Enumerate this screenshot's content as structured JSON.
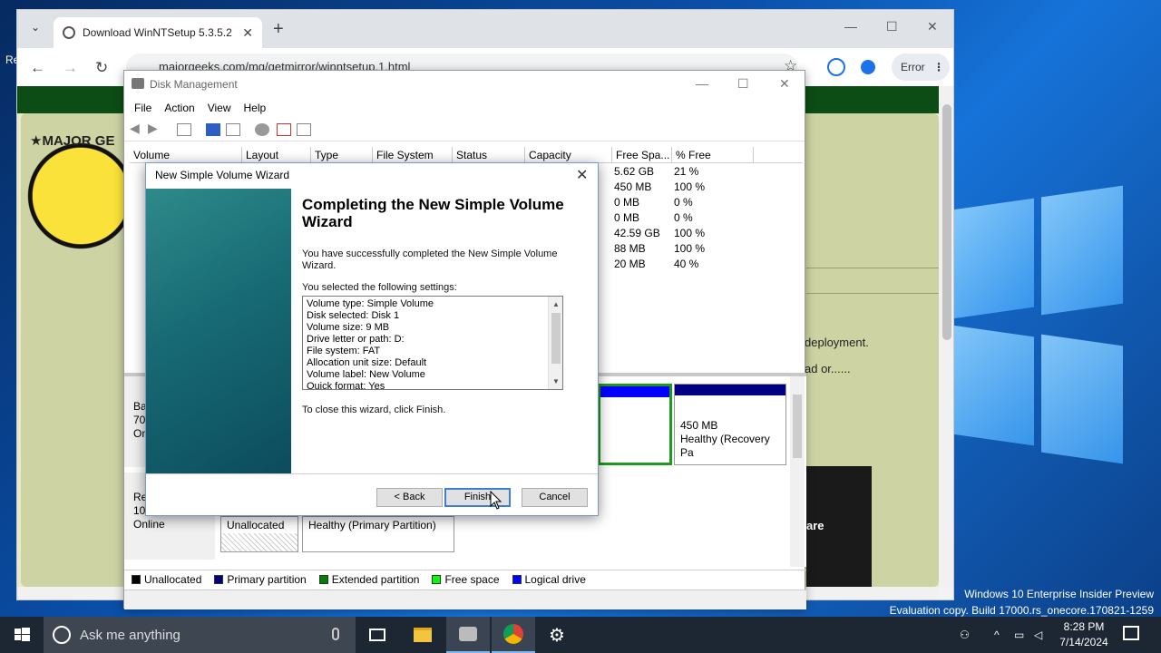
{
  "browser": {
    "tab_title": "Download WinNTSetup 5.3.5.2",
    "url": "majorgeeks.com/mg/getmirror/winntsetup,1.html",
    "error_label": "Error",
    "tab_search_glyph": "⌄",
    "close_glyph": "✕",
    "new_tab_glyph": "+",
    "minimize_glyph": "—",
    "maximize_glyph": "☐",
    "back_glyph": "←",
    "forward_glyph": "→",
    "reload_glyph": "↻",
    "star_glyph": "☆",
    "menu_glyph": "⋮"
  },
  "page": {
    "logo_text": "★MAJOR GE",
    "text_deployment": "deployment.",
    "text_load": "ad or......",
    "image_text": "are"
  },
  "disk_mgmt": {
    "title": "Disk Management",
    "menu": [
      "File",
      "Action",
      "View",
      "Help"
    ],
    "columns": [
      "Volume",
      "Layout",
      "Type",
      "File System",
      "Status",
      "Capacity",
      "Free Spa...",
      "% Free"
    ],
    "rows": [
      {
        "free": "5.62 GB",
        "pct": "21 %"
      },
      {
        "free": "450 MB",
        "pct": "100 %"
      },
      {
        "free": "0 MB",
        "pct": "0 %"
      },
      {
        "free": "0 MB",
        "pct": "0 %"
      },
      {
        "free": "42.59 GB",
        "pct": "100 %"
      },
      {
        "free": "88 MB",
        "pct": "100 %"
      },
      {
        "free": "20 MB",
        "pct": "40 %"
      }
    ],
    "disk0": {
      "label1": "Ba",
      "label2": "70.",
      "label3": "On"
    },
    "disk1": {
      "label1": "Re",
      "label2": "10",
      "status": "Online"
    },
    "recovery": {
      "size": "450 MB",
      "status": "Healthy (Recovery Pa"
    },
    "unallocated_label": "Unallocated",
    "primary_status": "Healthy (Primary Partition)",
    "legend": [
      {
        "label": "Unallocated",
        "color": "#000000"
      },
      {
        "label": "Primary partition",
        "color": "#000080"
      },
      {
        "label": "Extended partition",
        "color": "#008000"
      },
      {
        "label": "Free space",
        "color": "#00ff00"
      },
      {
        "label": "Logical drive",
        "color": "#0000ff"
      }
    ]
  },
  "wizard": {
    "title": "New Simple Volume Wizard",
    "heading": "Completing the New Simple Volume Wizard",
    "success_text": "You have successfully completed the New Simple Volume Wizard.",
    "settings_intro": "You selected the following settings:",
    "settings": [
      "Volume type: Simple Volume",
      "Disk selected: Disk 1",
      "Volume size: 9 MB",
      "Drive letter or path: D:",
      "File system: FAT",
      "Allocation unit size: Default",
      "Volume label: New Volume",
      "Quick format: Yes"
    ],
    "close_text": "To close this wizard, click Finish.",
    "back_button": "< Back",
    "finish_button": "Finish",
    "cancel_button": "Cancel"
  },
  "desktop": {
    "watermark_line1": "Windows 10 Enterprise Insider Preview",
    "watermark_line2": "Evaluation copy. Build 17000.rs_onecore.170821-1259",
    "left_edge_text": "Re"
  },
  "taskbar": {
    "search_placeholder": "Ask me anything",
    "time": "8:28 PM",
    "date": "7/14/2024"
  }
}
